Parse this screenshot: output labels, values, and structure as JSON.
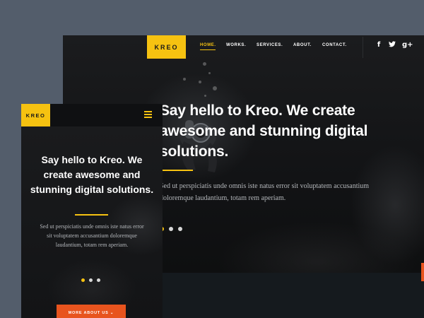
{
  "desktop": {
    "logo": "KREO",
    "nav": [
      "HOME.",
      "WORKS.",
      "SERVICES.",
      "ABOUT.",
      "CONTACT."
    ],
    "social": [
      "f",
      "•",
      "g+"
    ],
    "social_icons": [
      "facebook-icon",
      "twitter-icon",
      "google-plus-icon"
    ],
    "headline": "Say hello to Kreo. We create awesome and stunning digital solutions.",
    "body": "Sed ut perspiciatis unde omnis iste natus error sit voluptatem accusantium doloremque laudantium, totam rem aperiam.",
    "active_slide": 1,
    "slide_count": 3
  },
  "mobile": {
    "logo": "KREO",
    "menu_icon": "hamburger-menu-icon",
    "headline": "Say hello to Kreo. We create awesome and stunning digital solutions.",
    "body": "Sed ut perspiciatis unde omnis iste natus error sit voluptatem accusantium doloremque laudantium, totam rem aperiam.",
    "button_label": "MORE ABOUT US ⌄",
    "active_slide": 1,
    "slide_count": 3
  },
  "colors": {
    "accent": "#f6c211",
    "button": "#e8541e",
    "background": "#535d6b"
  }
}
